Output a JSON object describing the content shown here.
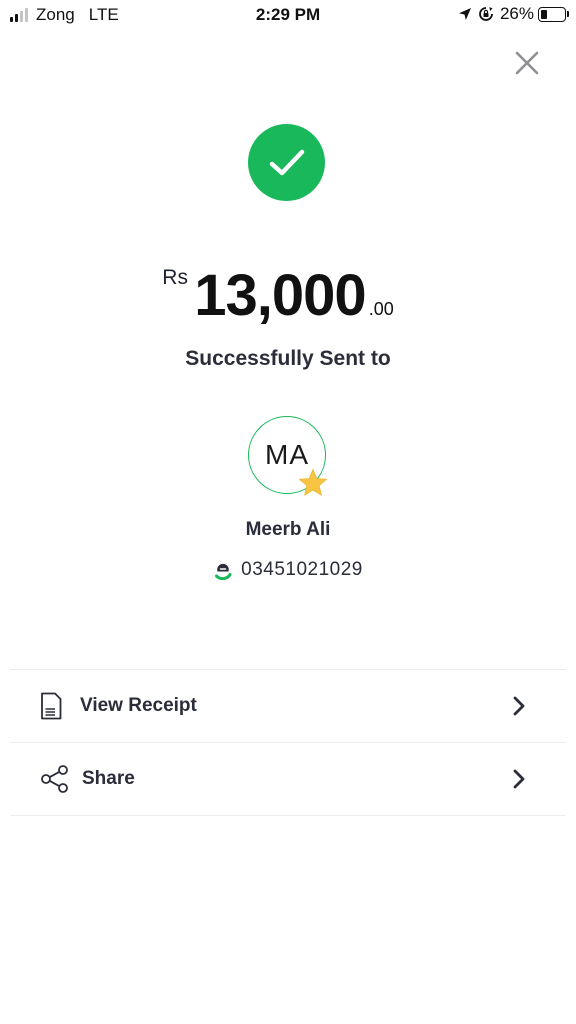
{
  "status_bar": {
    "carrier": "Zong",
    "network": "LTE",
    "time": "2:29 PM",
    "battery_percent": "26%",
    "battery_level": 0.26,
    "signal_bars": 2,
    "signal_total": 4,
    "icons": [
      "signal-icon",
      "location-arrow-icon",
      "rotation-lock-icon",
      "battery-icon"
    ]
  },
  "close": {
    "icon": "close-icon"
  },
  "success": {
    "icon": "checkmark-icon",
    "color": "#19b85a",
    "currency": "Rs",
    "amount": "13,000",
    "decimal": ".00",
    "message": "Successfully Sent to"
  },
  "recipient": {
    "initials": "MA",
    "name": "Meerb Ali",
    "phone": "03451021029",
    "favorite_icon": "star-icon",
    "wallet_icon": "wallet-logo-icon",
    "star_color": "#f7c543"
  },
  "actions": [
    {
      "label": "View Receipt",
      "icon": "receipt-icon"
    },
    {
      "label": "Share",
      "icon": "share-icon"
    }
  ],
  "colors": {
    "accent": "#19b85a",
    "text": "#2b2d3a",
    "divider": "#ececef"
  }
}
